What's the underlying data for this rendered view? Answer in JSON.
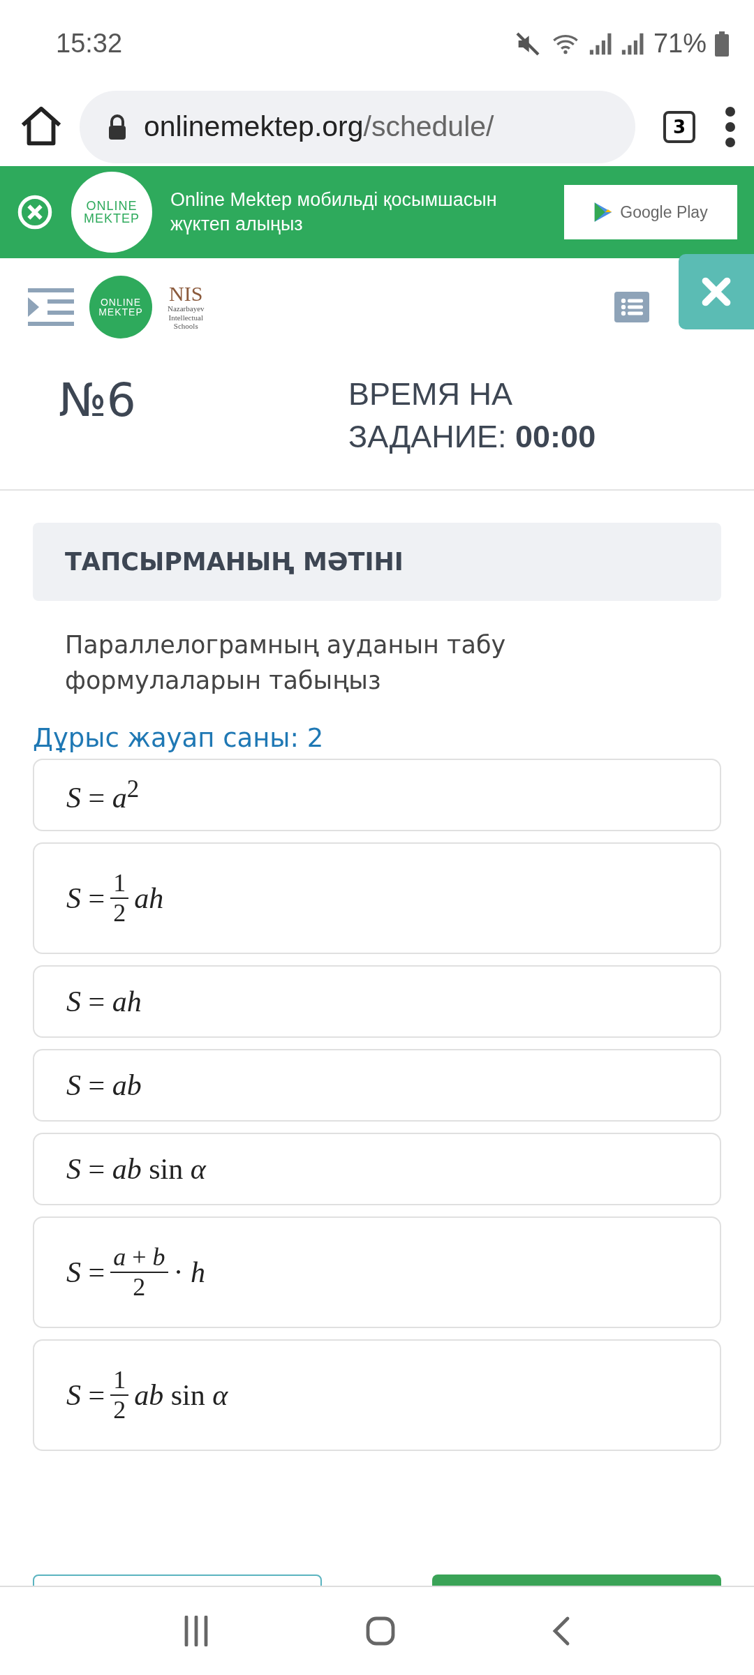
{
  "status_bar": {
    "time": "15:32",
    "battery": "71%"
  },
  "browser": {
    "url_host": "onlinemektep.org",
    "url_path": "/schedule/",
    "tab_count": "3"
  },
  "app_banner": {
    "logo_top": "ONLINE",
    "logo_bottom": "MEKTEP",
    "message": "Online Mektep мобильді қосымшасын жүктеп алыңыз",
    "store_button": "Google Play"
  },
  "header": {
    "logo_top": "ONLINE",
    "logo_bottom": "MEKTEP",
    "nis_title": "NIS",
    "nis_lines": [
      "Nazarbayev",
      "Intellectual",
      "Schools"
    ]
  },
  "task": {
    "number": "№6",
    "timer_label": "ВРЕМЯ НА ЗАДАНИЕ:",
    "timer_value": "00:00"
  },
  "section_title": "ТАПСЫРМАНЫҢ МӘТІНІ",
  "question": "Параллелограмның ауданын табу формулаларын табыңыз",
  "answer_count": "Дұрыс жауап саны: 2",
  "options": [
    {
      "kind": "plain",
      "text": "*S* = *a*$^{2}$",
      "selected": false
    },
    {
      "kind": "fraction",
      "lead": "*S* =",
      "numerator": "1",
      "denominator": "2",
      "trail": "*ah*",
      "selected": false
    },
    {
      "kind": "plain",
      "text": "*S* = *ah*",
      "selected": false
    },
    {
      "kind": "plain",
      "text": "*S* = *ab*",
      "selected": false
    },
    {
      "kind": "plain",
      "text": "*S* = *ab* sin *α*",
      "selected": false
    },
    {
      "kind": "fraction",
      "lead": "*S* =",
      "numerator": "*a* + *b*",
      "denominator": "2",
      "trail": "· *h*",
      "selected": false
    },
    {
      "kind": "fraction",
      "lead": "*S* =",
      "numerator": "1",
      "denominator": "2",
      "trail": "*ab* sin *α*",
      "selected": false
    }
  ]
}
